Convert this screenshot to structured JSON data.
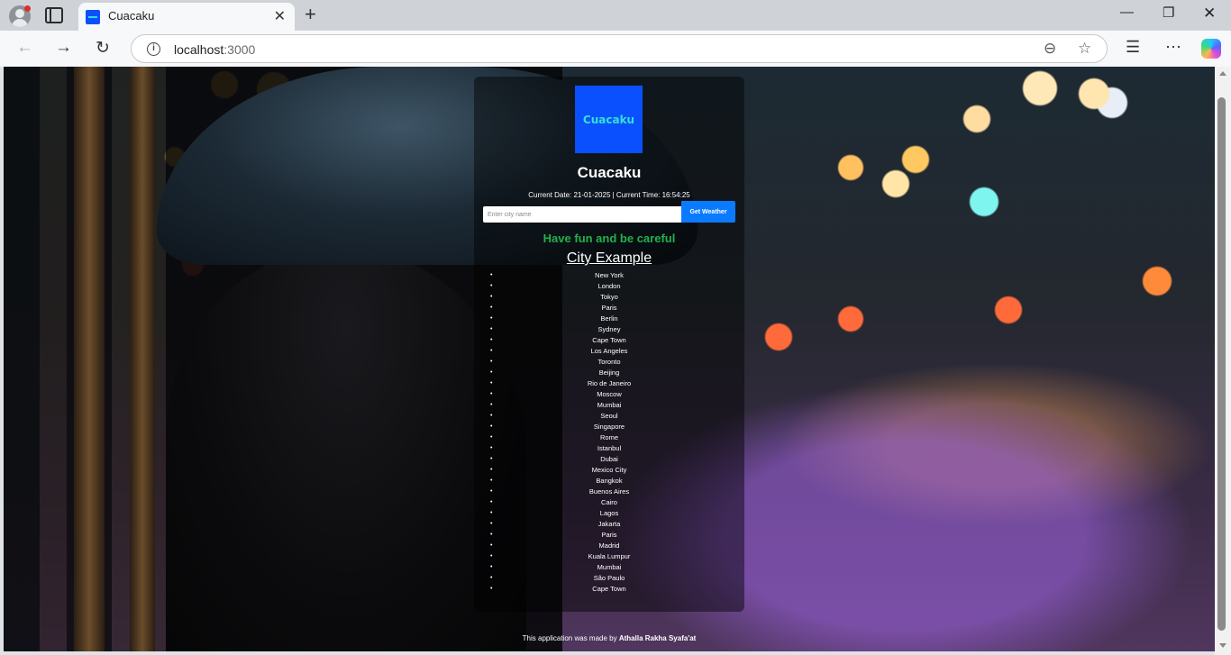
{
  "browser": {
    "tab_title": "Cuacaku",
    "url_host": "localhost",
    "url_port": ":3000",
    "icons": {
      "profile": "profile-icon",
      "tab_actions": "tab-actions-icon",
      "favicon": "cuacaku-favicon",
      "close_tab": "close-icon",
      "new_tab": "plus-icon",
      "back": "arrow-left-icon",
      "forward": "arrow-right-icon",
      "reload": "reload-icon",
      "site_info": "info-icon",
      "zoom": "zoom-out-icon",
      "favorite": "star-icon",
      "favorites": "favorites-icon",
      "more": "more-icon",
      "copilot": "copilot-icon"
    }
  },
  "app": {
    "logo_text": "Cuacaku",
    "title": "Cuacaku",
    "datetime": "Current Date: 21-01-2025 | Current Time: 16:54:25",
    "search": {
      "placeholder": "Enter city name",
      "value": "",
      "button_label": "Get Weather"
    },
    "motto": "Have fun and be careful",
    "example_heading": "City Example",
    "cities": [
      "New York",
      "London",
      "Tokyo",
      "Paris",
      "Berlin",
      "Sydney",
      "Cape Town",
      "Los Angeles",
      "Toronto",
      "Beijing",
      "Rio de Janeiro",
      "Moscow",
      "Mumbai",
      "Seoul",
      "Singapore",
      "Rome",
      "Istanbul",
      "Dubai",
      "Mexico City",
      "Bangkok",
      "Buenos Aires",
      "Cairo",
      "Lagos",
      "Jakarta",
      "Paris",
      "Madrid",
      "Kuala Lumpur",
      "Mumbai",
      "São Paulo",
      "Cape Town"
    ],
    "footer_prefix": "This application was made by",
    "footer_author": "Athalla Rakha Syafa'at"
  },
  "colors": {
    "logo_bg": "#0a50ff",
    "logo_text": "#34e2d2",
    "button_bg": "#0a7bff",
    "motto": "#22b14c"
  }
}
